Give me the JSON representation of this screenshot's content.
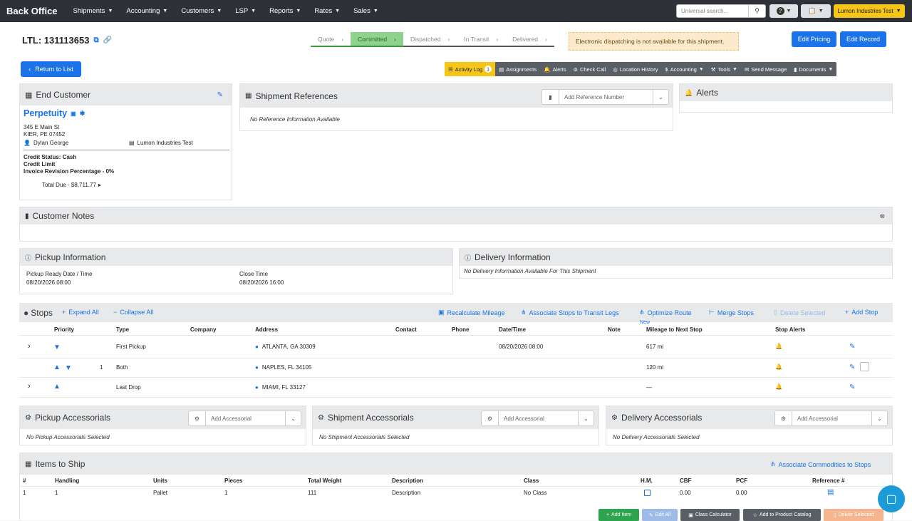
{
  "nav": {
    "brand": "Back Office",
    "items": [
      "Shipments",
      "Accounting",
      "Customers",
      "LSP",
      "Reports",
      "Rates",
      "Sales"
    ],
    "search_placeholder": "Universal search...",
    "help": "?",
    "company": "Lumon Industries Test"
  },
  "header": {
    "title": "LTL: 131113653",
    "steps": [
      "Quote",
      "Committed",
      "Dispatched",
      "In Transit",
      "Delivered"
    ],
    "warning": "Electronic dispatching is not available for this shipment.",
    "edit_pricing": "Edit Pricing",
    "edit_record": "Edit Record",
    "return": "Return to List"
  },
  "tabs": {
    "activity": "Activity Log",
    "activity_count": "1",
    "assignments": "Assignments",
    "alerts": "Alerts",
    "check_call": "Check Call",
    "location_history": "Location History",
    "accounting": "Accounting",
    "tools": "Tools",
    "send_message": "Send Message",
    "documents": "Documents"
  },
  "end_customer": {
    "title": "End Customer",
    "name": "Perpetuity",
    "address1": "345 E Main St",
    "address2": "KIER, PE 07452",
    "contact": "Dylan George",
    "company": "Lumon Industries Test",
    "credit_status": "Credit Status: Cash",
    "credit_limit": "Credit Limit",
    "invoice_rev": "Invoice Revision Percentage - 0%",
    "total_due": "Total Due - $8,711.77"
  },
  "references": {
    "title": "Shipment References",
    "placeholder": "Add Reference Number",
    "empty": "No Reference Information Available"
  },
  "alerts": {
    "title": "Alerts"
  },
  "notes": {
    "title": "Customer Notes"
  },
  "pickup": {
    "title": "Pickup Information",
    "ready_label": "Pickup Ready Date / Time",
    "ready_value": "08/20/2026 08:00",
    "close_label": "Close Time",
    "close_value": "08/20/2026 16:00"
  },
  "delivery": {
    "title": "Delivery Information",
    "empty": "No Delivery Information Available For This Shipment"
  },
  "stops": {
    "title": "Stops",
    "expand": "Expand All",
    "collapse": "Collapse All",
    "recalc": "Recalculate Mileage",
    "associate": "Associate Stops to Transit Legs",
    "optimize": "Optimize Route",
    "optimize_badge": "New",
    "merge": "Merge Stops",
    "delete": "Delete Selected",
    "add": "Add Stop",
    "columns": [
      "Priority",
      "Type",
      "Company",
      "Address",
      "Contact",
      "Phone",
      "Date/Time",
      "Note",
      "Mileage to Next Stop",
      "Stop Alerts"
    ],
    "rows": [
      {
        "priority": "",
        "type": "First Pickup",
        "address": "ATLANTA, GA 30309",
        "datetime": "08/20/2026 08:00",
        "mileage": "617 mi"
      },
      {
        "priority": "1",
        "type": "Both",
        "address": "NAPLES, FL 34105",
        "datetime": "",
        "mileage": "120 mi"
      },
      {
        "priority": "",
        "type": "Last Drop",
        "address": "MIAMI, FL 33127",
        "datetime": "",
        "mileage": "—"
      }
    ]
  },
  "accessorials": {
    "pickup_title": "Pickup Accessorials",
    "pickup_empty": "No Pickup Accessorials Selected",
    "shipment_title": "Shipment Accessorials",
    "shipment_empty": "No Shipment Accessorials Selected",
    "delivery_title": "Delivery Accessorials",
    "delivery_empty": "No Delivery Accessorials Selected",
    "placeholder": "Add Accessorial"
  },
  "items": {
    "title": "Items to Ship",
    "associate": "Associate Commodities to Stops",
    "columns": [
      "#",
      "Handling",
      "Units",
      "Pieces",
      "Total Weight",
      "Description",
      "Class",
      "H.M.",
      "CBF",
      "PCF",
      "Reference #"
    ],
    "row": {
      "num": "1",
      "handling": "1",
      "units": "Pallet",
      "pieces": "1",
      "weight": "111",
      "description": "Description",
      "class": "No Class",
      "cbf": "0.00",
      "pcf": "0.00"
    },
    "buttons": {
      "add": "Add Item",
      "edit": "Edit All",
      "calc": "Class Calculator",
      "catalog": "Add to Product Catalog",
      "delete": "Delete Selected"
    }
  },
  "colors": {
    "accent": "#1a73e8",
    "nav": "#2e3238",
    "brand_yellow": "#f5c518",
    "committed": "#8fd18f"
  }
}
